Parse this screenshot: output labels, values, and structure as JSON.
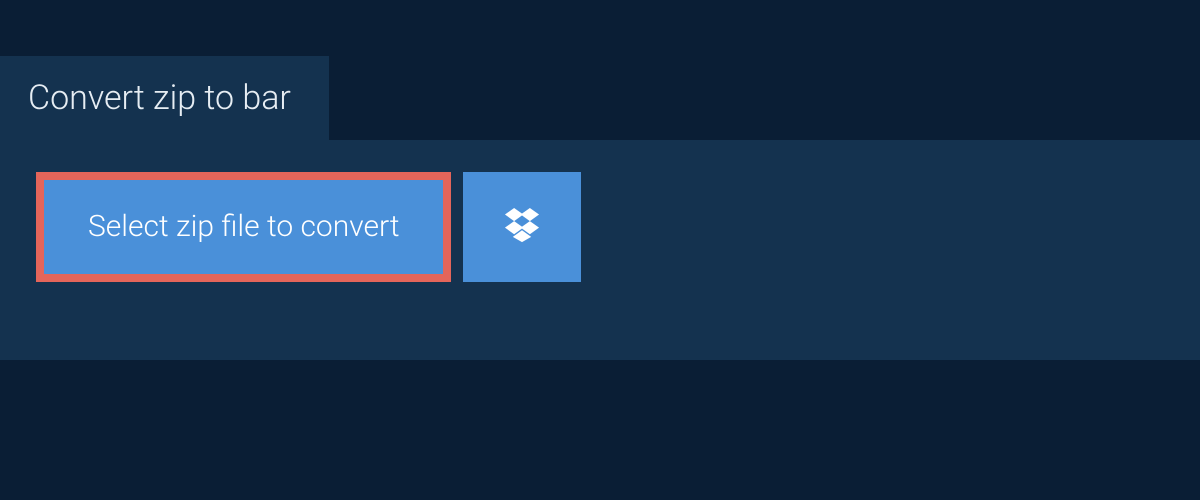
{
  "tab": {
    "title": "Convert zip to bar"
  },
  "actions": {
    "select_label": "Select zip file to convert"
  }
}
